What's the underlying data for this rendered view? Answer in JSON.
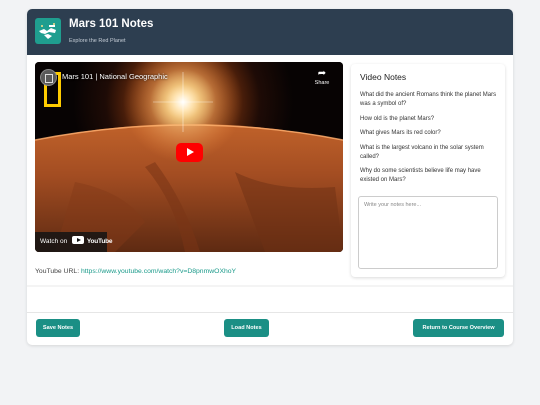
{
  "header": {
    "title": "Mars 101 Notes",
    "subtitle": "Explore the Red Planet"
  },
  "video": {
    "title": "Mars 101 | National Geographic",
    "share_label": "Share",
    "share_icon": "share-arrow-icon",
    "watch_on": "Watch on",
    "youtube_wordmark": "YouTube"
  },
  "url": {
    "label": "YouTube URL:",
    "link": "https://www.youtube.com/watch?v=D8pnmwOXhoY"
  },
  "questions": {
    "title": "Video Notes",
    "items": [
      "What did the ancient Romans think the planet Mars was a symbol of?",
      "How old is the planet Mars?",
      "What gives Mars its red color?",
      "What is the largest volcano in the solar system called?",
      "Why do some scientists believe life may have existed on Mars?"
    ]
  },
  "notes": {
    "placeholder": "Write your notes here..."
  },
  "buttons": {
    "save": "Save Notes",
    "load": "Load Notes",
    "return": "Return to Course Overview"
  },
  "colors": {
    "header_bg": "#2d3e50",
    "accent": "#1b8f85",
    "link": "#1a9a8a",
    "play": "#ff0000"
  }
}
